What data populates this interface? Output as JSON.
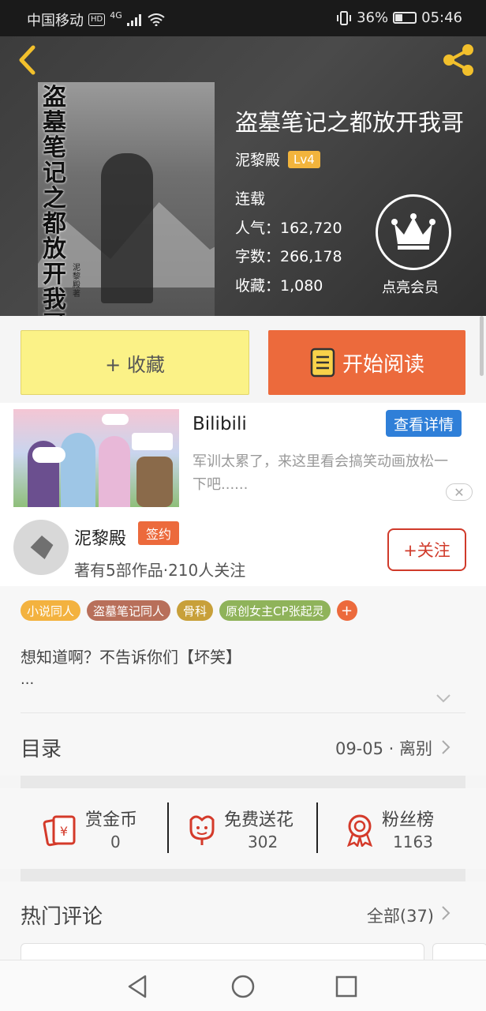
{
  "status_bar": {
    "carrier": "中国移动",
    "hd": "HD",
    "network": "4G",
    "battery": "36%",
    "time": "05:46"
  },
  "header": {
    "cover_title_vertical": "盗墓笔记之都放开我哥",
    "cover_author_vertical": "泥黎殿著",
    "book_title": "盗墓笔记之都放开我哥",
    "author": "泥黎殿",
    "level": "Lv4",
    "status": "连载",
    "popularity": "人气：162,720",
    "words": "字数：266,178",
    "favorites": "收藏：1,080",
    "vip_label": "点亮会员"
  },
  "actions": {
    "favorite_label": "+ 收藏",
    "read_label": "开始阅读"
  },
  "ad": {
    "title": "Bilibili",
    "detail_label": "查看详情",
    "description": "军训太累了，来这里看会搞笑动画放松一下吧......",
    "close_symbol": "✕"
  },
  "author_block": {
    "name": "泥黎殿",
    "badge": "签约",
    "meta": "著有5部作品·210人关注",
    "follow_label": "+关注"
  },
  "tags": [
    {
      "label": "小说同人",
      "color": "#f3b23f"
    },
    {
      "label": "盗墓笔记同人",
      "color": "#b86f5a"
    },
    {
      "label": "骨科",
      "color": "#c8a03a"
    },
    {
      "label": "原创女主CP张起灵",
      "color": "#8fb35a"
    }
  ],
  "tag_more": "+",
  "description": {
    "line1": "想知道啊？不告诉你们【坏笑】",
    "line2": "..."
  },
  "toc": {
    "label": "目录",
    "latest": "09-05 · 离别"
  },
  "rewards": [
    {
      "label": "赏金币",
      "value": "0",
      "icon": "coin-envelope-icon"
    },
    {
      "label": "免费送花",
      "value": "302",
      "icon": "flower-icon"
    },
    {
      "label": "粉丝榜",
      "value": "1163",
      "icon": "medal-icon"
    }
  ],
  "comments": {
    "title": "热门评论",
    "all_label": "全部(37)"
  },
  "colors": {
    "accent_orange": "#ec6a3c",
    "favorite_yellow": "#fbf287",
    "level_badge": "#f2b43c",
    "follow_red": "#d03a2a",
    "ad_button_blue": "#2f7fd8"
  }
}
